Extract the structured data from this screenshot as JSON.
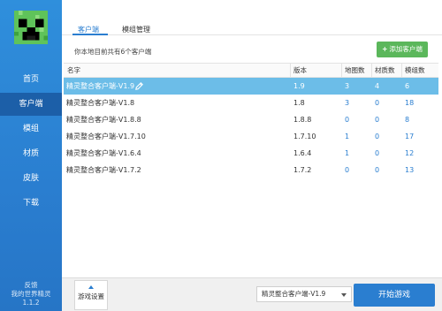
{
  "sidebar": {
    "items": [
      {
        "label": "首页"
      },
      {
        "label": "客户端"
      },
      {
        "label": "模组"
      },
      {
        "label": "材质"
      },
      {
        "label": "皮肤"
      },
      {
        "label": "下载"
      }
    ],
    "feedback": "反馈",
    "app_name": "我的世界精灵",
    "version": "1.1.2"
  },
  "tabs": [
    {
      "label": "客户端"
    },
    {
      "label": "模组管理"
    }
  ],
  "info_text": "你本地目前共有6个客户端",
  "add_button": {
    "plus": "+",
    "label": "添加客户端"
  },
  "table": {
    "headers": [
      "名字",
      "版本",
      "地图数",
      "材质数",
      "模组数"
    ],
    "rows": [
      {
        "name": "精灵整合客户端-V1.9",
        "version": "1.9",
        "maps": "3",
        "textures": "4",
        "mods": "6"
      },
      {
        "name": "精灵整合客户端-V1.8",
        "version": "1.8",
        "maps": "3",
        "textures": "0",
        "mods": "18"
      },
      {
        "name": "精灵整合客户端-V1.8.8",
        "version": "1.8.8",
        "maps": "0",
        "textures": "0",
        "mods": "8"
      },
      {
        "name": "精灵整合客户端-V1.7.10",
        "version": "1.7.10",
        "maps": "1",
        "textures": "0",
        "mods": "17"
      },
      {
        "name": "精灵整合客户端-V1.6.4",
        "version": "1.6.4",
        "maps": "1",
        "textures": "0",
        "mods": "12"
      },
      {
        "name": "精灵整合客户端-V1.7.2",
        "version": "1.7.2",
        "maps": "0",
        "textures": "0",
        "mods": "13"
      }
    ]
  },
  "bottom": {
    "settings_label": "游戏设置",
    "selected_client": "精灵整合客户端-V1.9",
    "start_label": "开始游戏"
  },
  "colors": {
    "accent": "#2a7ed0",
    "selected_row": "#6cbde8",
    "add_button": "#5bb75b"
  },
  "icons": [
    "creeper-logo",
    "pencil-icon",
    "arrow-up-icon",
    "chevron-down-icon"
  ]
}
